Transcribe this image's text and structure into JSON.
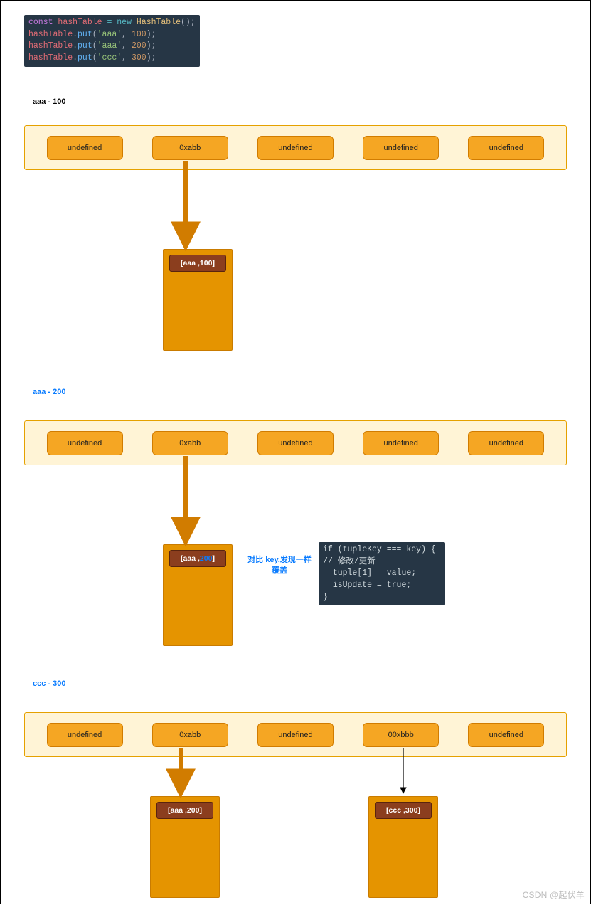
{
  "code1": {
    "l1_const": "const",
    "l1_var": "hashTable",
    "l1_eq": "=",
    "l1_new": "new",
    "l1_cls": "HashTable",
    "l1_tail": "();",
    "l234_obj": "hashTable",
    "l234_dot": ".",
    "l234_put": "put",
    "l2_args_a": "'aaa'",
    "l2_args_b": "100",
    "l3_args_a": "'aaa'",
    "l3_args_b": "200",
    "l4_args_a": "'ccc'",
    "l4_args_b": "300",
    "open": "(",
    "comma": ", ",
    "close": ");"
  },
  "sections": {
    "s1": "aaa - 100",
    "s2": "aaa - 200",
    "s3": "ccc - 300"
  },
  "row1": {
    "slots": [
      "undefined",
      "0xabb",
      "undefined",
      "undefined",
      "undefined"
    ]
  },
  "row2": {
    "slots": [
      "undefined",
      "0xabb",
      "undefined",
      "undefined",
      "undefined"
    ]
  },
  "row3": {
    "slots": [
      "undefined",
      "0xabb",
      "undefined",
      "00xbbb",
      "undefined"
    ]
  },
  "bucket1": {
    "key": "aaa",
    "val": "100"
  },
  "bucket2": {
    "key": "aaa",
    "val": "200"
  },
  "bucket3a": {
    "key": "aaa",
    "val": "200"
  },
  "bucket3b": {
    "key": "ccc",
    "val": "300"
  },
  "annot": {
    "line1": "对比 key,发现一样",
    "line2": "覆盖"
  },
  "code2": {
    "l1_if": "if",
    "l1_rest_a": "(tupleKey",
    "l1_eq": "===",
    "l1_rest_b": "key) {",
    "l2_cmt": "// 修改/更新",
    "l3_a": "tuple[",
    "l3_n": "1",
    "l3_b": "] = value;",
    "l4_a": "isUpdate =",
    "l4_t": "true",
    "l4_s": ";",
    "l5": "}"
  },
  "watermark": "CSDN @起伏羊"
}
